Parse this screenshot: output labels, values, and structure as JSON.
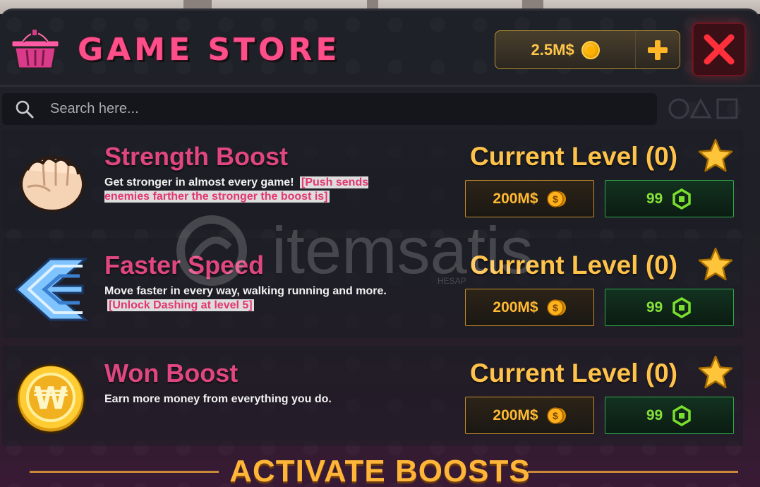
{
  "header": {
    "title": "GAME STORE",
    "currency": "2.5M$",
    "add_currency_icon": "plus-icon",
    "close_icon": "close-icon"
  },
  "search": {
    "placeholder": "Search here..."
  },
  "items": [
    {
      "name": "Strength Boost",
      "icon": "fist-icon",
      "description": "Get stronger in almost every game!",
      "tag": "[Push sends enemies farther the stronger the boost is]",
      "level": "Current Level (0)",
      "price_coins": "200M$",
      "price_robux": "99"
    },
    {
      "name": "Faster Speed",
      "icon": "speed-arrows-icon",
      "description": "Move faster in every way, walking running and more.",
      "tag": "[Unlock Dashing at level 5]",
      "level": "Current Level (0)",
      "price_coins": "200M$",
      "price_robux": "99"
    },
    {
      "name": "Won Boost",
      "icon": "won-coin-icon",
      "description": "Earn more money from everything you do.",
      "tag": "",
      "level": "Current Level (0)",
      "price_coins": "200M$",
      "price_robux": "99"
    }
  ],
  "footer": {
    "title": "ACTIVATE BOOSTS"
  },
  "watermark": {
    "text": "itemsatis",
    "subtext": "HESAP"
  },
  "colors": {
    "accent_pink": "#e0467f",
    "gold": "#ffc24a",
    "green": "#86e23a",
    "close_red": "#e8242f"
  }
}
